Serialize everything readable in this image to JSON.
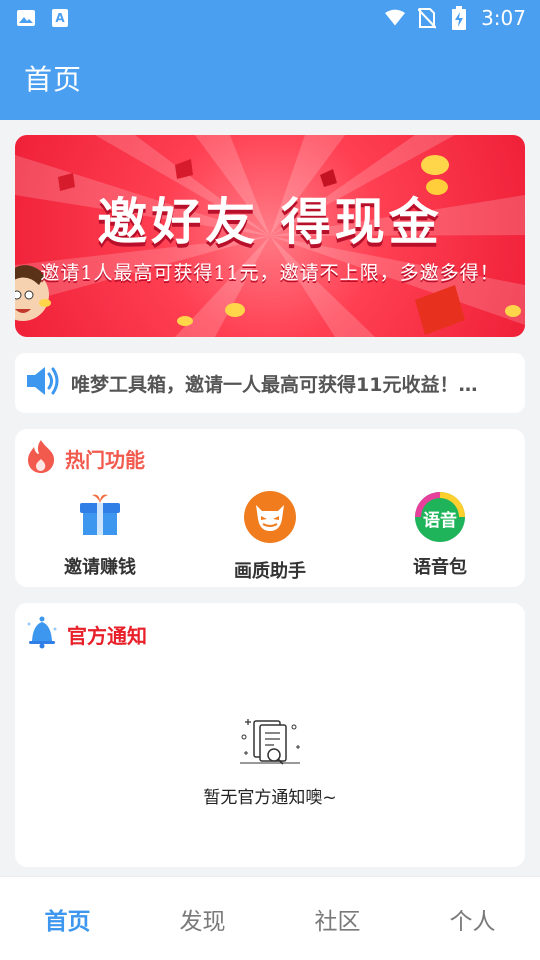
{
  "status_bar": {
    "time": "3:07",
    "left_icons": [
      "gallery-icon",
      "keyboard-icon"
    ],
    "right_icons": [
      "wifi-icon",
      "no-sim-icon",
      "battery-charging-icon"
    ]
  },
  "appbar": {
    "title": "首页",
    "color": "#4a9ff0"
  },
  "banner": {
    "title": "邀好友 得现金",
    "subtitle": "邀请1人最高可获得11元，邀请不上限，多邀多得！"
  },
  "notice": {
    "icon": "speaker-icon",
    "text": "唯梦工具箱，邀请一人最高可获得11元收益！…"
  },
  "hot_section": {
    "title": "热门功能",
    "title_color": "#f25a4e",
    "icon": "flame-icon",
    "items": [
      {
        "label": "邀请赚钱",
        "icon": "gift-icon"
      },
      {
        "label": "画质助手",
        "icon": "devil-mask-icon"
      },
      {
        "label": "语音包",
        "icon": "voice-pack-icon",
        "icon_text": "语音"
      }
    ]
  },
  "official_section": {
    "title": "官方通知",
    "title_color": "#e8202a",
    "icon": "bell-icon",
    "empty_text": "暂无官方通知噢~"
  },
  "bottom_nav": {
    "active_color": "#3d97ef",
    "items": [
      {
        "label": "首页",
        "active": true
      },
      {
        "label": "发现",
        "active": false
      },
      {
        "label": "社区",
        "active": false
      },
      {
        "label": "个人",
        "active": false
      }
    ]
  }
}
